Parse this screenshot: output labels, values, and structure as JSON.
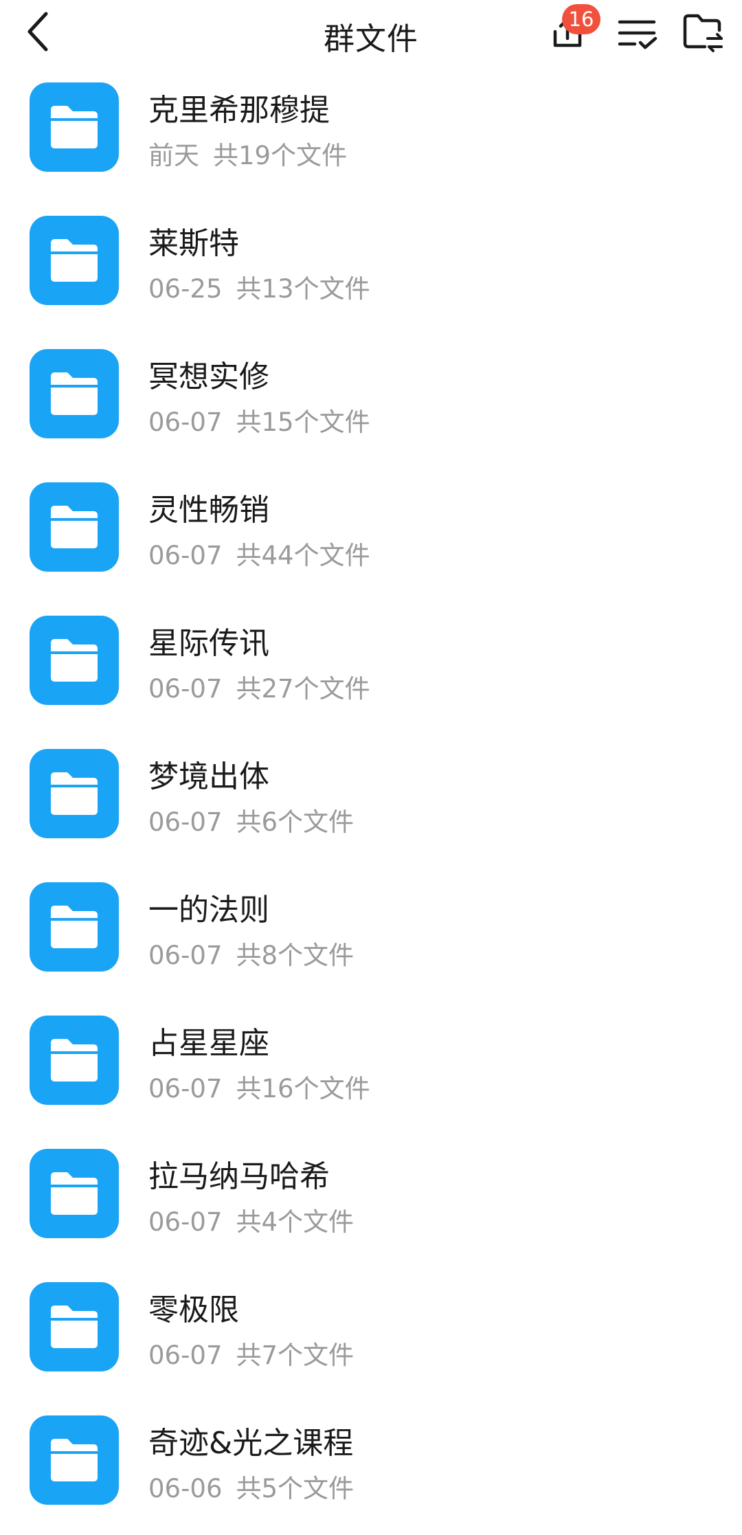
{
  "header": {
    "title": "群文件",
    "badge_count": "16",
    "icons": [
      "back-arrow-icon",
      "upload-icon",
      "sort-list-icon",
      "folder-switch-icon"
    ]
  },
  "colors": {
    "folder_blue": "#1aa4f5",
    "badge_red": "#f0503c",
    "text_primary": "#1a1a1a",
    "text_secondary": "#9a9a9a"
  },
  "folders": [
    {
      "name": "克里希那穆提",
      "date": "前天",
      "count": "共19个文件"
    },
    {
      "name": "莱斯特",
      "date": "06-25",
      "count": "共13个文件"
    },
    {
      "name": "冥想实修",
      "date": "06-07",
      "count": "共15个文件"
    },
    {
      "name": "灵性畅销",
      "date": "06-07",
      "count": "共44个文件"
    },
    {
      "name": "星际传讯",
      "date": "06-07",
      "count": "共27个文件"
    },
    {
      "name": "梦境出体",
      "date": "06-07",
      "count": "共6个文件"
    },
    {
      "name": "一的法则",
      "date": "06-07",
      "count": "共8个文件"
    },
    {
      "name": "占星星座",
      "date": "06-07",
      "count": "共16个文件"
    },
    {
      "name": "拉马纳马哈希",
      "date": "06-07",
      "count": "共4个文件"
    },
    {
      "name": "零极限",
      "date": "06-07",
      "count": "共7个文件"
    },
    {
      "name": "奇迹&光之课程",
      "date": "06-06",
      "count": "共5个文件"
    }
  ]
}
